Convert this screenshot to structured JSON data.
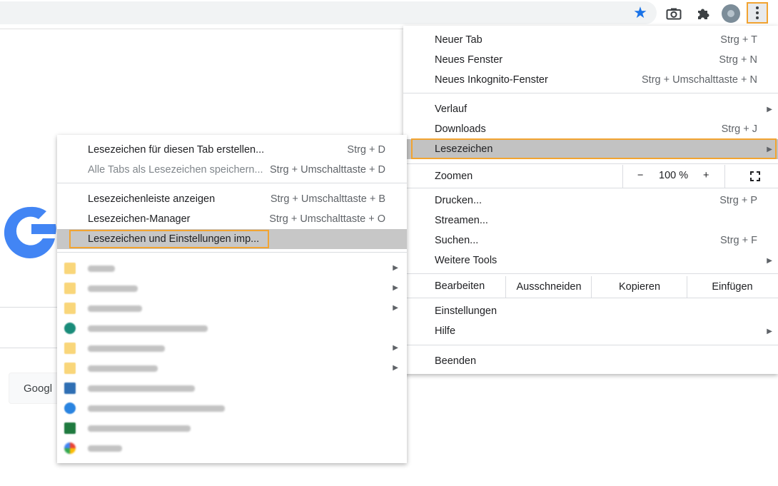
{
  "toolbar": {
    "icons": [
      "star-icon",
      "camera-icon",
      "extensions-icon",
      "profile-avatar",
      "more-menu-icon"
    ]
  },
  "page": {
    "search_button_label": "Googl"
  },
  "main_menu": {
    "new_tab": {
      "label": "Neuer Tab",
      "shortcut": "Strg + T"
    },
    "new_window": {
      "label": "Neues Fenster",
      "shortcut": "Strg + N"
    },
    "new_incognito": {
      "label": "Neues Inkognito-Fenster",
      "shortcut": "Strg + Umschalttaste + N"
    },
    "history": {
      "label": "Verlauf"
    },
    "downloads": {
      "label": "Downloads",
      "shortcut": "Strg + J"
    },
    "bookmarks": {
      "label": "Lesezeichen"
    },
    "zoom": {
      "label": "Zoomen",
      "minus": "−",
      "value": "100 %",
      "plus": "+"
    },
    "print": {
      "label": "Drucken...",
      "shortcut": "Strg + P"
    },
    "cast": {
      "label": "Streamen..."
    },
    "find": {
      "label": "Suchen...",
      "shortcut": "Strg + F"
    },
    "more_tools": {
      "label": "Weitere Tools"
    },
    "edit": {
      "label": "Bearbeiten",
      "cut": "Ausschneiden",
      "copy": "Kopieren",
      "paste": "Einfügen"
    },
    "settings": {
      "label": "Einstellungen"
    },
    "help": {
      "label": "Hilfe"
    },
    "exit": {
      "label": "Beenden"
    }
  },
  "bookmarks_menu": {
    "bookmark_tab": {
      "label": "Lesezeichen für diesen Tab erstellen...",
      "shortcut": "Strg + D"
    },
    "bookmark_all_tabs": {
      "label": "Alle Tabs als Lesezeichen speichern...",
      "shortcut": "Strg + Umschalttaste + D"
    },
    "show_bar": {
      "label": "Lesezeichenleiste anzeigen",
      "shortcut": "Strg + Umschalttaste + B"
    },
    "manager": {
      "label": "Lesezeichen-Manager",
      "shortcut": "Strg + Umschalttaste + O"
    },
    "import": {
      "label": "Lesezeichen und Einstellungen imp..."
    },
    "entries": [
      {
        "kind": "folder",
        "has_submenu": true
      },
      {
        "kind": "folder",
        "has_submenu": true
      },
      {
        "kind": "folder",
        "has_submenu": true
      },
      {
        "kind": "site",
        "icon": "teal-logo-icon",
        "has_submenu": false
      },
      {
        "kind": "folder",
        "has_submenu": true
      },
      {
        "kind": "folder",
        "has_submenu": true
      },
      {
        "kind": "site",
        "icon": "confluence-icon",
        "has_submenu": false
      },
      {
        "kind": "site",
        "icon": "blue-gear-icon",
        "has_submenu": false
      },
      {
        "kind": "site",
        "icon": "excel-icon",
        "has_submenu": false
      },
      {
        "kind": "site",
        "icon": "google-favicon-icon",
        "has_submenu": false
      }
    ]
  },
  "colors": {
    "highlight_outline": "#f2a431",
    "selected_row": "#c2c2c2",
    "star_blue": "#1a73e8"
  }
}
